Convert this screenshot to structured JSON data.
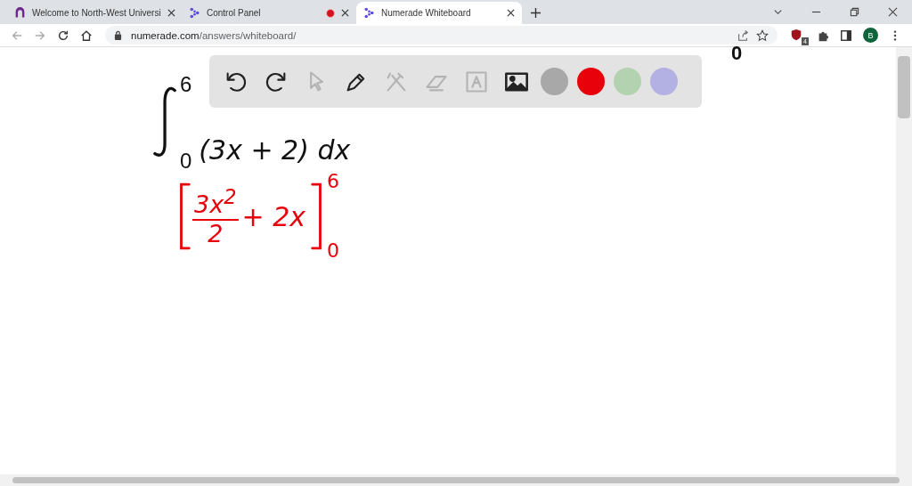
{
  "tabs": [
    {
      "title": "Welcome to North-West Universi",
      "selected": false,
      "recording": false
    },
    {
      "title": "Control Panel",
      "selected": false,
      "recording": true
    },
    {
      "title": "Numerade Whiteboard",
      "selected": true,
      "recording": false
    }
  ],
  "address": {
    "host": "numerade.com",
    "path": "/answers/whiteboard/"
  },
  "extension_badge": "4",
  "profile": "B",
  "toolbar": {
    "tools": [
      {
        "kind": "undo",
        "disabled": false
      },
      {
        "kind": "redo",
        "disabled": false
      },
      {
        "kind": "pointer",
        "disabled": true
      },
      {
        "kind": "pen",
        "disabled": false
      },
      {
        "kind": "shapes",
        "disabled": true
      },
      {
        "kind": "eraser",
        "disabled": true
      },
      {
        "kind": "text",
        "disabled": true
      },
      {
        "kind": "image",
        "disabled": false
      }
    ],
    "swatches": [
      {
        "color": "#a8a8a8"
      },
      {
        "color": "#e8000b"
      },
      {
        "color": "#b3d3b0"
      },
      {
        "color": "#b3b0e3"
      }
    ]
  },
  "board": {
    "corner_mark": "0",
    "integral": {
      "upper": "6",
      "lower": "0",
      "body": "(3x + 2) dx"
    },
    "answer": {
      "numerator": "3x$^{2}$",
      "denominator": "2",
      "rest": "+ 2x",
      "upper": "6",
      "lower": "0"
    }
  }
}
